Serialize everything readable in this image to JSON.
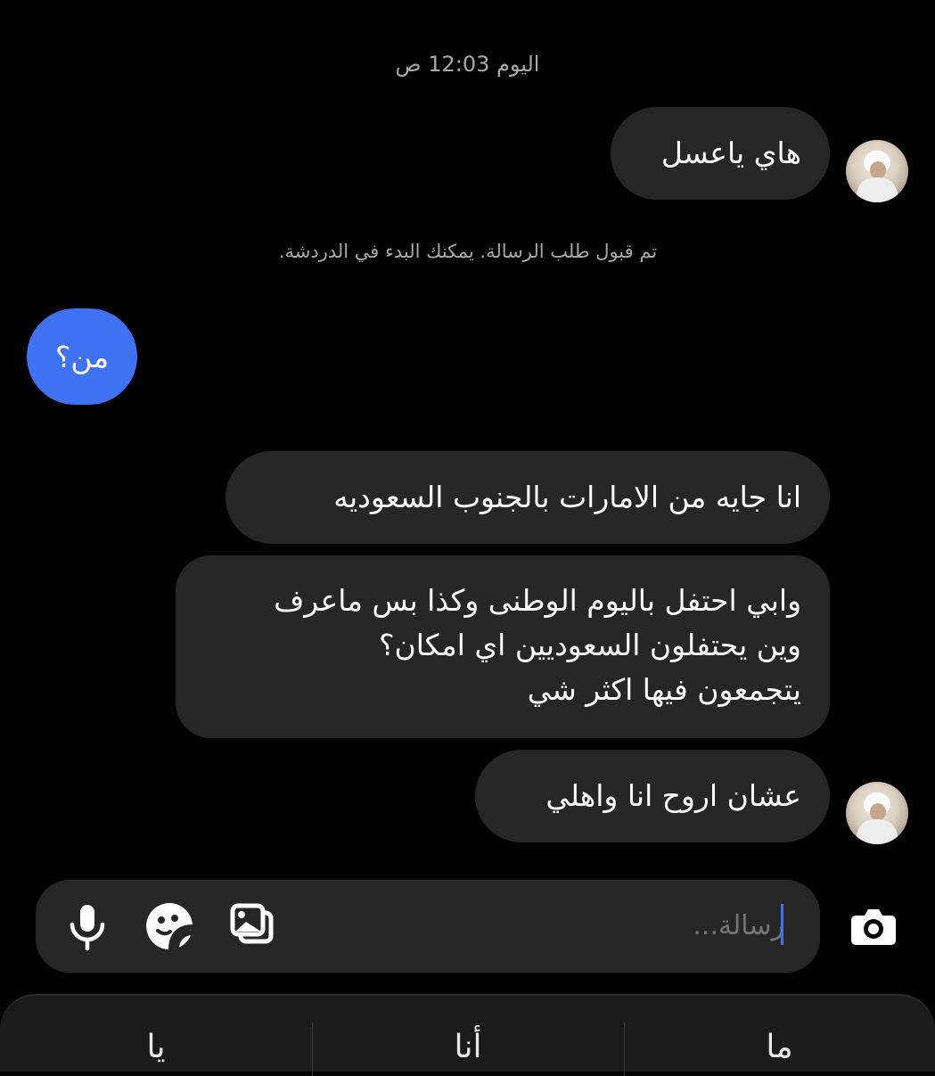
{
  "chat": {
    "timestamp": "اليوم 12:03 ص",
    "system_note": "تم قبول طلب الرسالة. يمكنك البدء في الدردشة.",
    "messages": [
      {
        "sender": "incoming",
        "text": "هاي ياعسل"
      },
      {
        "sender": "outgoing",
        "text": "من؟"
      },
      {
        "sender": "incoming",
        "text": "انا جايه من الامارات بالجنوب السعوديه"
      },
      {
        "sender": "incoming",
        "lines": [
          "وابي احتفل باليوم الوطنى وكذا بس ماعرف",
          "وين يحتفلون السعوديين اي امكان؟",
          "يتجمعون فيها اكثر شي"
        ]
      },
      {
        "sender": "incoming",
        "text": "عشان اروح انا واهلي"
      }
    ]
  },
  "composer": {
    "placeholder": "رسالة...",
    "camera_icon": "camera-icon",
    "gallery_icon": "gallery-icon",
    "sticker_icon": "sticker-icon",
    "mic_icon": "microphone-icon"
  },
  "keyboard": {
    "suggestions": [
      "ما",
      "أنا",
      "يا"
    ]
  },
  "colors": {
    "background": "#000000",
    "incoming_bubble": "#262626",
    "outgoing_bubble": "#3e72f3",
    "muted_text": "#a8a8a8"
  }
}
